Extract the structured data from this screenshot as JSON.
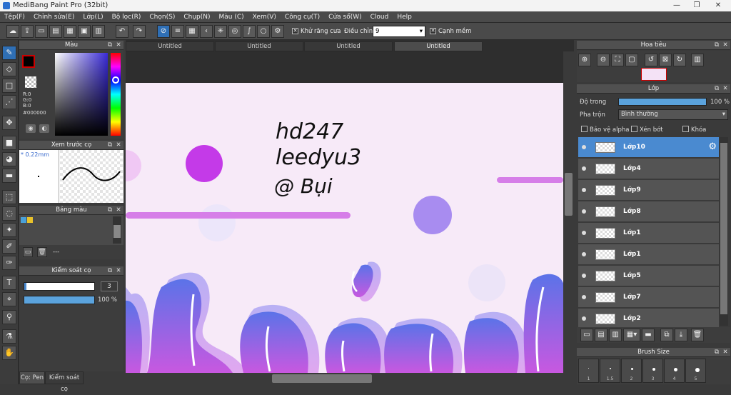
{
  "window": {
    "title": "MediBang Paint Pro (32bit)",
    "min": "—",
    "max": "❐",
    "close": "✕"
  },
  "menu": [
    "Tệp(F)",
    "Chỉnh sửa(E)",
    "Lớp(L)",
    "Bộ lọc(R)",
    "Chọn(S)",
    "Chụp(N)",
    "Màu (C)",
    "Xem(V)",
    "Công cụ(T)",
    "Cửa sổ(W)",
    "Cloud",
    "Help"
  ],
  "toolbar": {
    "antialias_label": "Khử răng cưa",
    "adjust_label": "Điều chỉnh",
    "adjust_value": "9",
    "edge_label": "Cạnh mềm",
    "antialias_checked": "✕",
    "edge_checked": "✕"
  },
  "tabs": [
    "Untitled",
    "Untitled",
    "Untitled",
    "Untitled"
  ],
  "color_panel": {
    "title": "Màu",
    "r": "R:0",
    "g": "G:0",
    "b": "B:0",
    "hex": "#000000"
  },
  "brush_preview": {
    "title": "Xem trước cọ",
    "size": "0.22mm"
  },
  "palette": {
    "title": "Bảng màu",
    "dash": "---"
  },
  "brush_control": {
    "title": "Kiểm soát cọ",
    "size_value": "3",
    "opacity_value": "100 %",
    "opacity_fraction": 1.0
  },
  "bottom_tabs": {
    "pen": "Cọ: Pen",
    "control": "Kiểm soát cọ"
  },
  "navigator": {
    "title": "Hoa tiêu"
  },
  "layer_panel": {
    "title": "Lớp",
    "opacity_label": "Độ trong",
    "opacity_value": "100 %",
    "blend_label": "Pha trộn",
    "blend_value": "Bình thường",
    "protect_alpha": "Bảo vệ alpha",
    "clip": "Xén bớt",
    "lock": "Khóa",
    "layers": [
      "Lớp10",
      "Lớp4",
      "Lớp9",
      "Lớp8",
      "Lớp1",
      "Lớp1",
      "Lớp5",
      "Lớp7",
      "Lớp2"
    ]
  },
  "brush_size": {
    "title": "Brush Size",
    "sizes": [
      "1",
      "1.5",
      "2",
      "3",
      "4",
      "5"
    ]
  },
  "canvas_text": {
    "line1": "hd247",
    "line2": "leedyu3",
    "line3": "@ Bụi"
  },
  "colors": {
    "accent": "#2f6fb5",
    "selected_layer": "#4a8ad0",
    "canvas_bg": "#f7eaf8"
  }
}
